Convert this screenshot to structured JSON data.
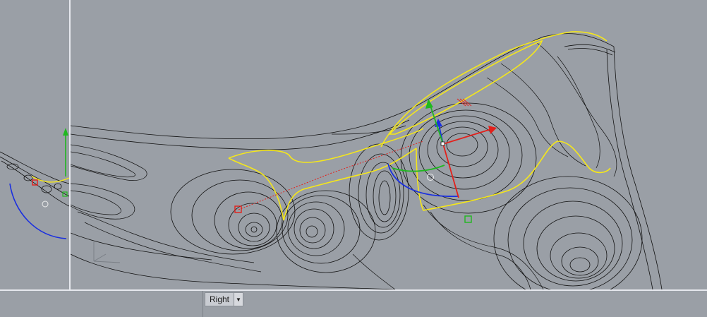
{
  "viewport": {
    "active_name": "Right",
    "menu_icon": "chevron-down-icon"
  },
  "colors": {
    "background": "#9a9fa6",
    "contour": "#111111",
    "highlight_curve": "#f5e71a",
    "gumball_x": "#e3201b",
    "gumball_y": "#1fb81f",
    "gumball_z": "#1a2fe0",
    "viewport_border": "#e6e8ee"
  }
}
